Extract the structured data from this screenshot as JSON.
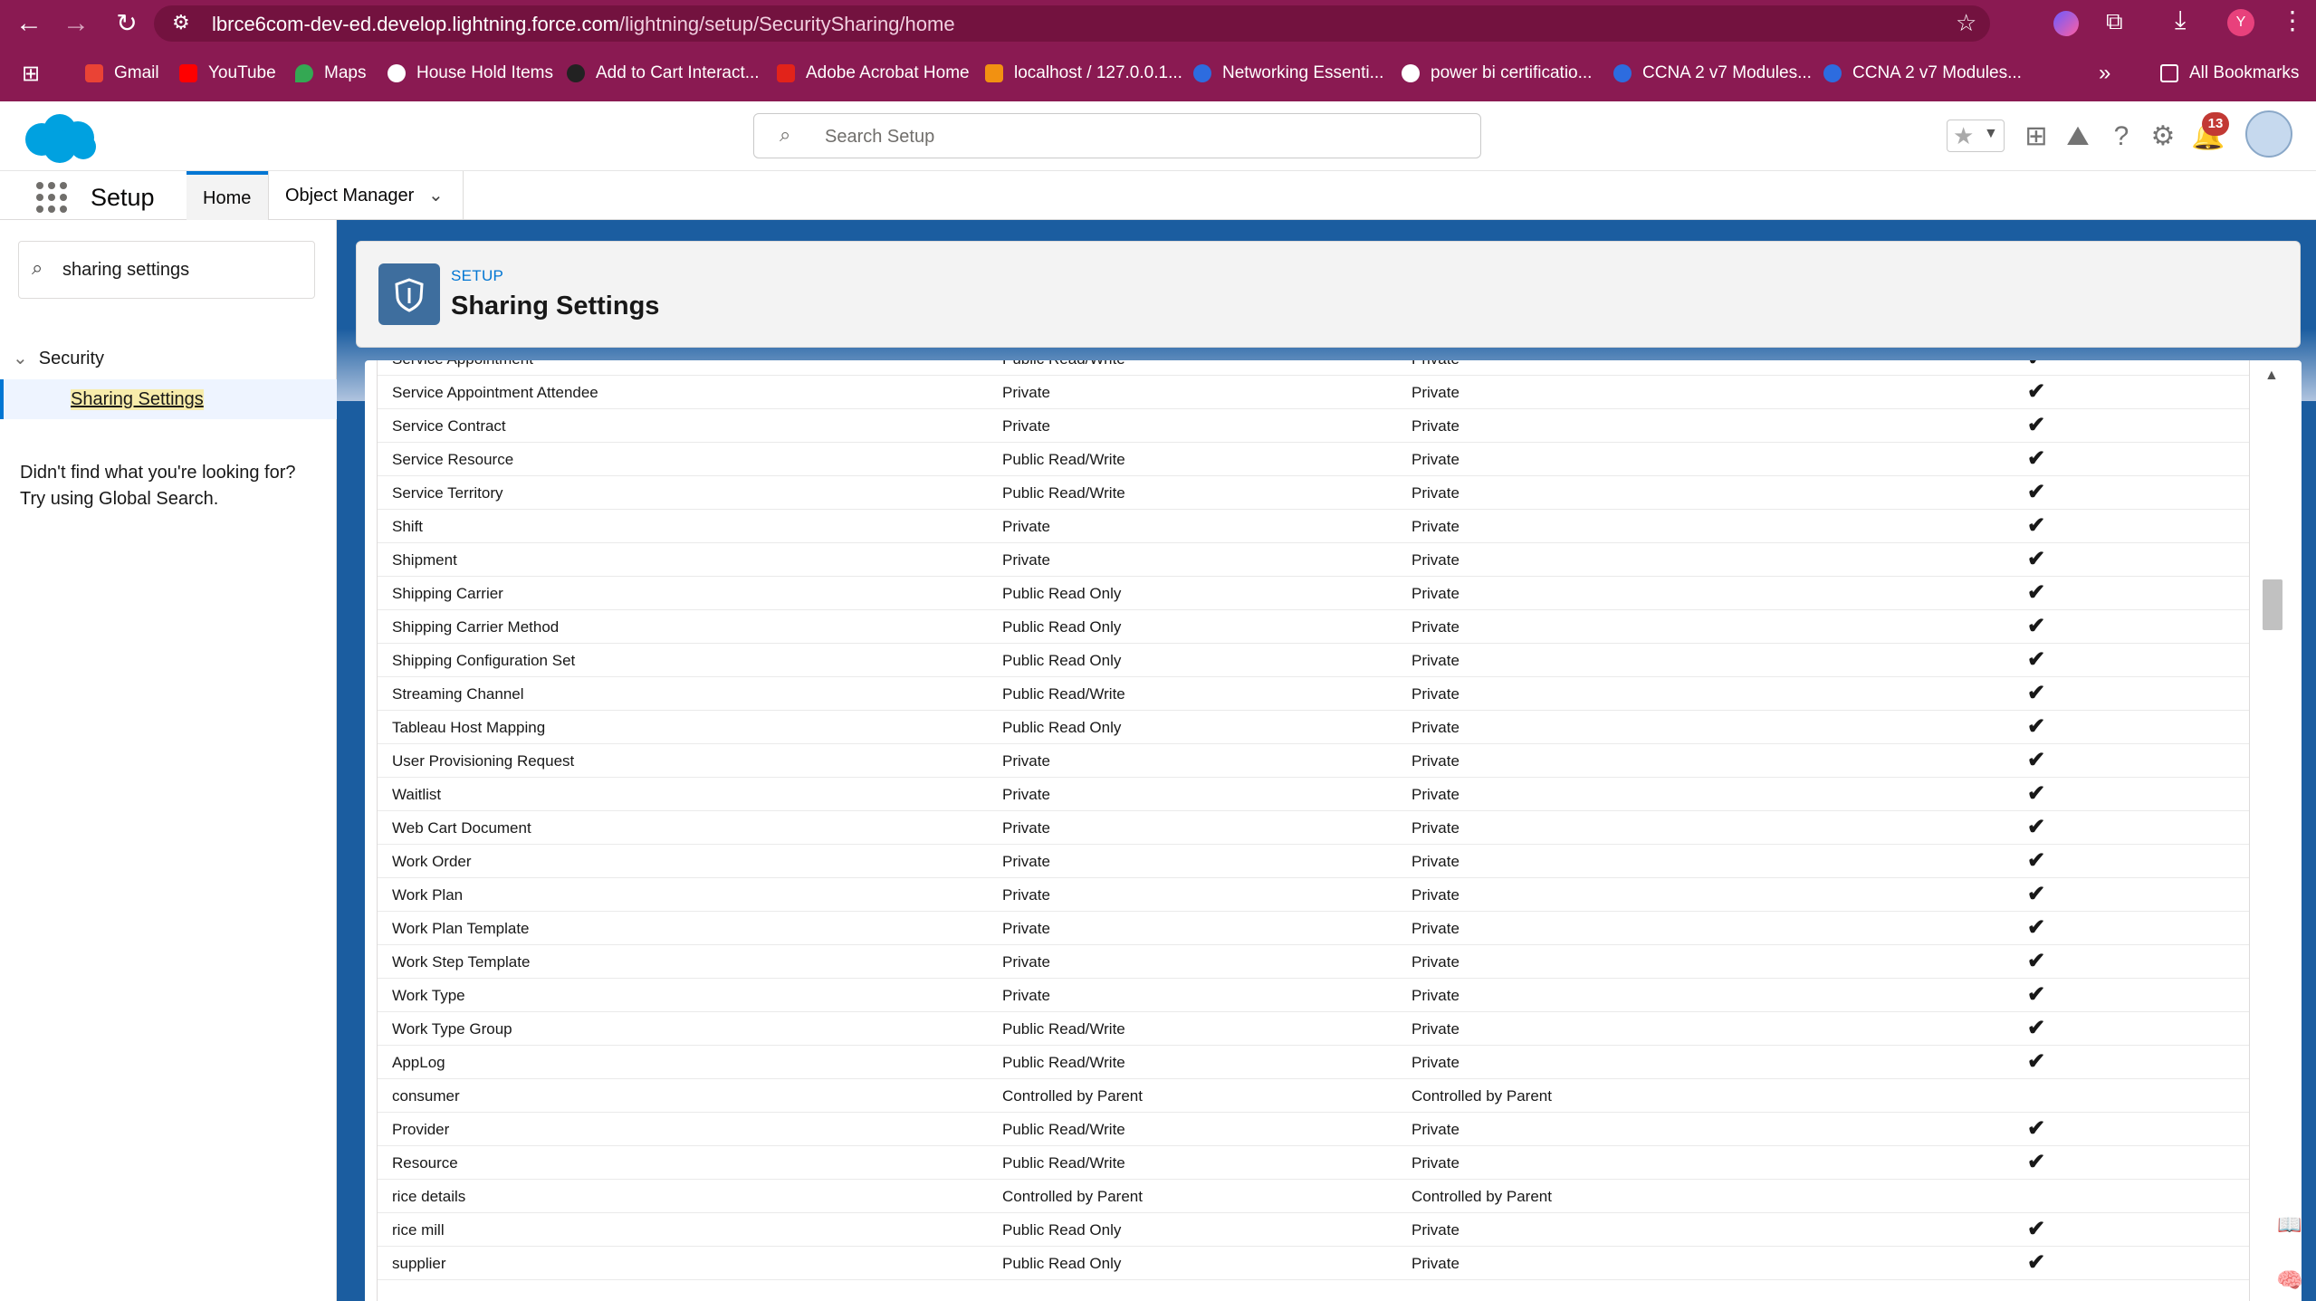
{
  "browser": {
    "url_host": "lbrce6com-dev-ed.develop.lightning.force.com",
    "url_path": "/lightning/setup/SecuritySharing/home",
    "profile_initial": "Y",
    "bookmarks": [
      "Gmail",
      "YouTube",
      "Maps",
      "House Hold Items",
      "Add to Cart Interact...",
      "Adobe Acrobat Home",
      "localhost / 127.0.0.1...",
      "Networking Essenti...",
      "power bi certificatio...",
      "CCNA 2 v7 Modules...",
      "CCNA 2 v7 Modules..."
    ],
    "more_bookmarks": "»",
    "all_bookmarks": "All Bookmarks"
  },
  "header": {
    "search_placeholder": "Search Setup",
    "notification_count": "13"
  },
  "setup_nav": {
    "app_name": "Setup",
    "tab_home": "Home",
    "tab_object_manager": "Object Manager"
  },
  "sidebar": {
    "quick_find_value": "sharing settings",
    "tree_parent": "Security",
    "tree_child": "Sharing Settings",
    "not_found_line1": "Didn't find what you're looking for?",
    "not_found_line2": "Try using Global Search."
  },
  "page": {
    "crumb": "SETUP",
    "title": "Sharing Settings"
  },
  "table": {
    "rows": [
      {
        "object": "Service Appointment",
        "internal": "Public Read/Write",
        "external": "Private",
        "check": "✔"
      },
      {
        "object": "Service Appointment Attendee",
        "internal": "Private",
        "external": "Private",
        "check": "✔"
      },
      {
        "object": "Service Contract",
        "internal": "Private",
        "external": "Private",
        "check": "✔"
      },
      {
        "object": "Service Resource",
        "internal": "Public Read/Write",
        "external": "Private",
        "check": "✔"
      },
      {
        "object": "Service Territory",
        "internal": "Public Read/Write",
        "external": "Private",
        "check": "✔"
      },
      {
        "object": "Shift",
        "internal": "Private",
        "external": "Private",
        "check": "✔"
      },
      {
        "object": "Shipment",
        "internal": "Private",
        "external": "Private",
        "check": "✔"
      },
      {
        "object": "Shipping Carrier",
        "internal": "Public Read Only",
        "external": "Private",
        "check": "✔"
      },
      {
        "object": "Shipping Carrier Method",
        "internal": "Public Read Only",
        "external": "Private",
        "check": "✔"
      },
      {
        "object": "Shipping Configuration Set",
        "internal": "Public Read Only",
        "external": "Private",
        "check": "✔"
      },
      {
        "object": "Streaming Channel",
        "internal": "Public Read/Write",
        "external": "Private",
        "check": "✔"
      },
      {
        "object": "Tableau Host Mapping",
        "internal": "Public Read Only",
        "external": "Private",
        "check": "✔"
      },
      {
        "object": "User Provisioning Request",
        "internal": "Private",
        "external": "Private",
        "check": "✔"
      },
      {
        "object": "Waitlist",
        "internal": "Private",
        "external": "Private",
        "check": "✔"
      },
      {
        "object": "Web Cart Document",
        "internal": "Private",
        "external": "Private",
        "check": "✔"
      },
      {
        "object": "Work Order",
        "internal": "Private",
        "external": "Private",
        "check": "✔"
      },
      {
        "object": "Work Plan",
        "internal": "Private",
        "external": "Private",
        "check": "✔"
      },
      {
        "object": "Work Plan Template",
        "internal": "Private",
        "external": "Private",
        "check": "✔"
      },
      {
        "object": "Work Step Template",
        "internal": "Private",
        "external": "Private",
        "check": "✔"
      },
      {
        "object": "Work Type",
        "internal": "Private",
        "external": "Private",
        "check": "✔"
      },
      {
        "object": "Work Type Group",
        "internal": "Public Read/Write",
        "external": "Private",
        "check": "✔"
      },
      {
        "object": "AppLog",
        "internal": "Public Read/Write",
        "external": "Private",
        "check": "✔"
      },
      {
        "object": "consumer",
        "internal": "Controlled by Parent",
        "external": "Controlled by Parent",
        "check": ""
      },
      {
        "object": "Provider",
        "internal": "Public Read/Write",
        "external": "Private",
        "check": "✔"
      },
      {
        "object": "Resource",
        "internal": "Public Read/Write",
        "external": "Private",
        "check": "✔"
      },
      {
        "object": "rice details",
        "internal": "Controlled by Parent",
        "external": "Controlled by Parent",
        "check": ""
      },
      {
        "object": "rice mill",
        "internal": "Public Read Only",
        "external": "Private",
        "check": "✔"
      },
      {
        "object": "supplier",
        "internal": "Public Read Only",
        "external": "Private",
        "check": "✔"
      }
    ]
  },
  "colors": {
    "browser_bar": "#8a1a52",
    "brand_blue": "#0176d3",
    "notification_red": "#c23934",
    "header_icon_bg": "#3e6e9e"
  }
}
